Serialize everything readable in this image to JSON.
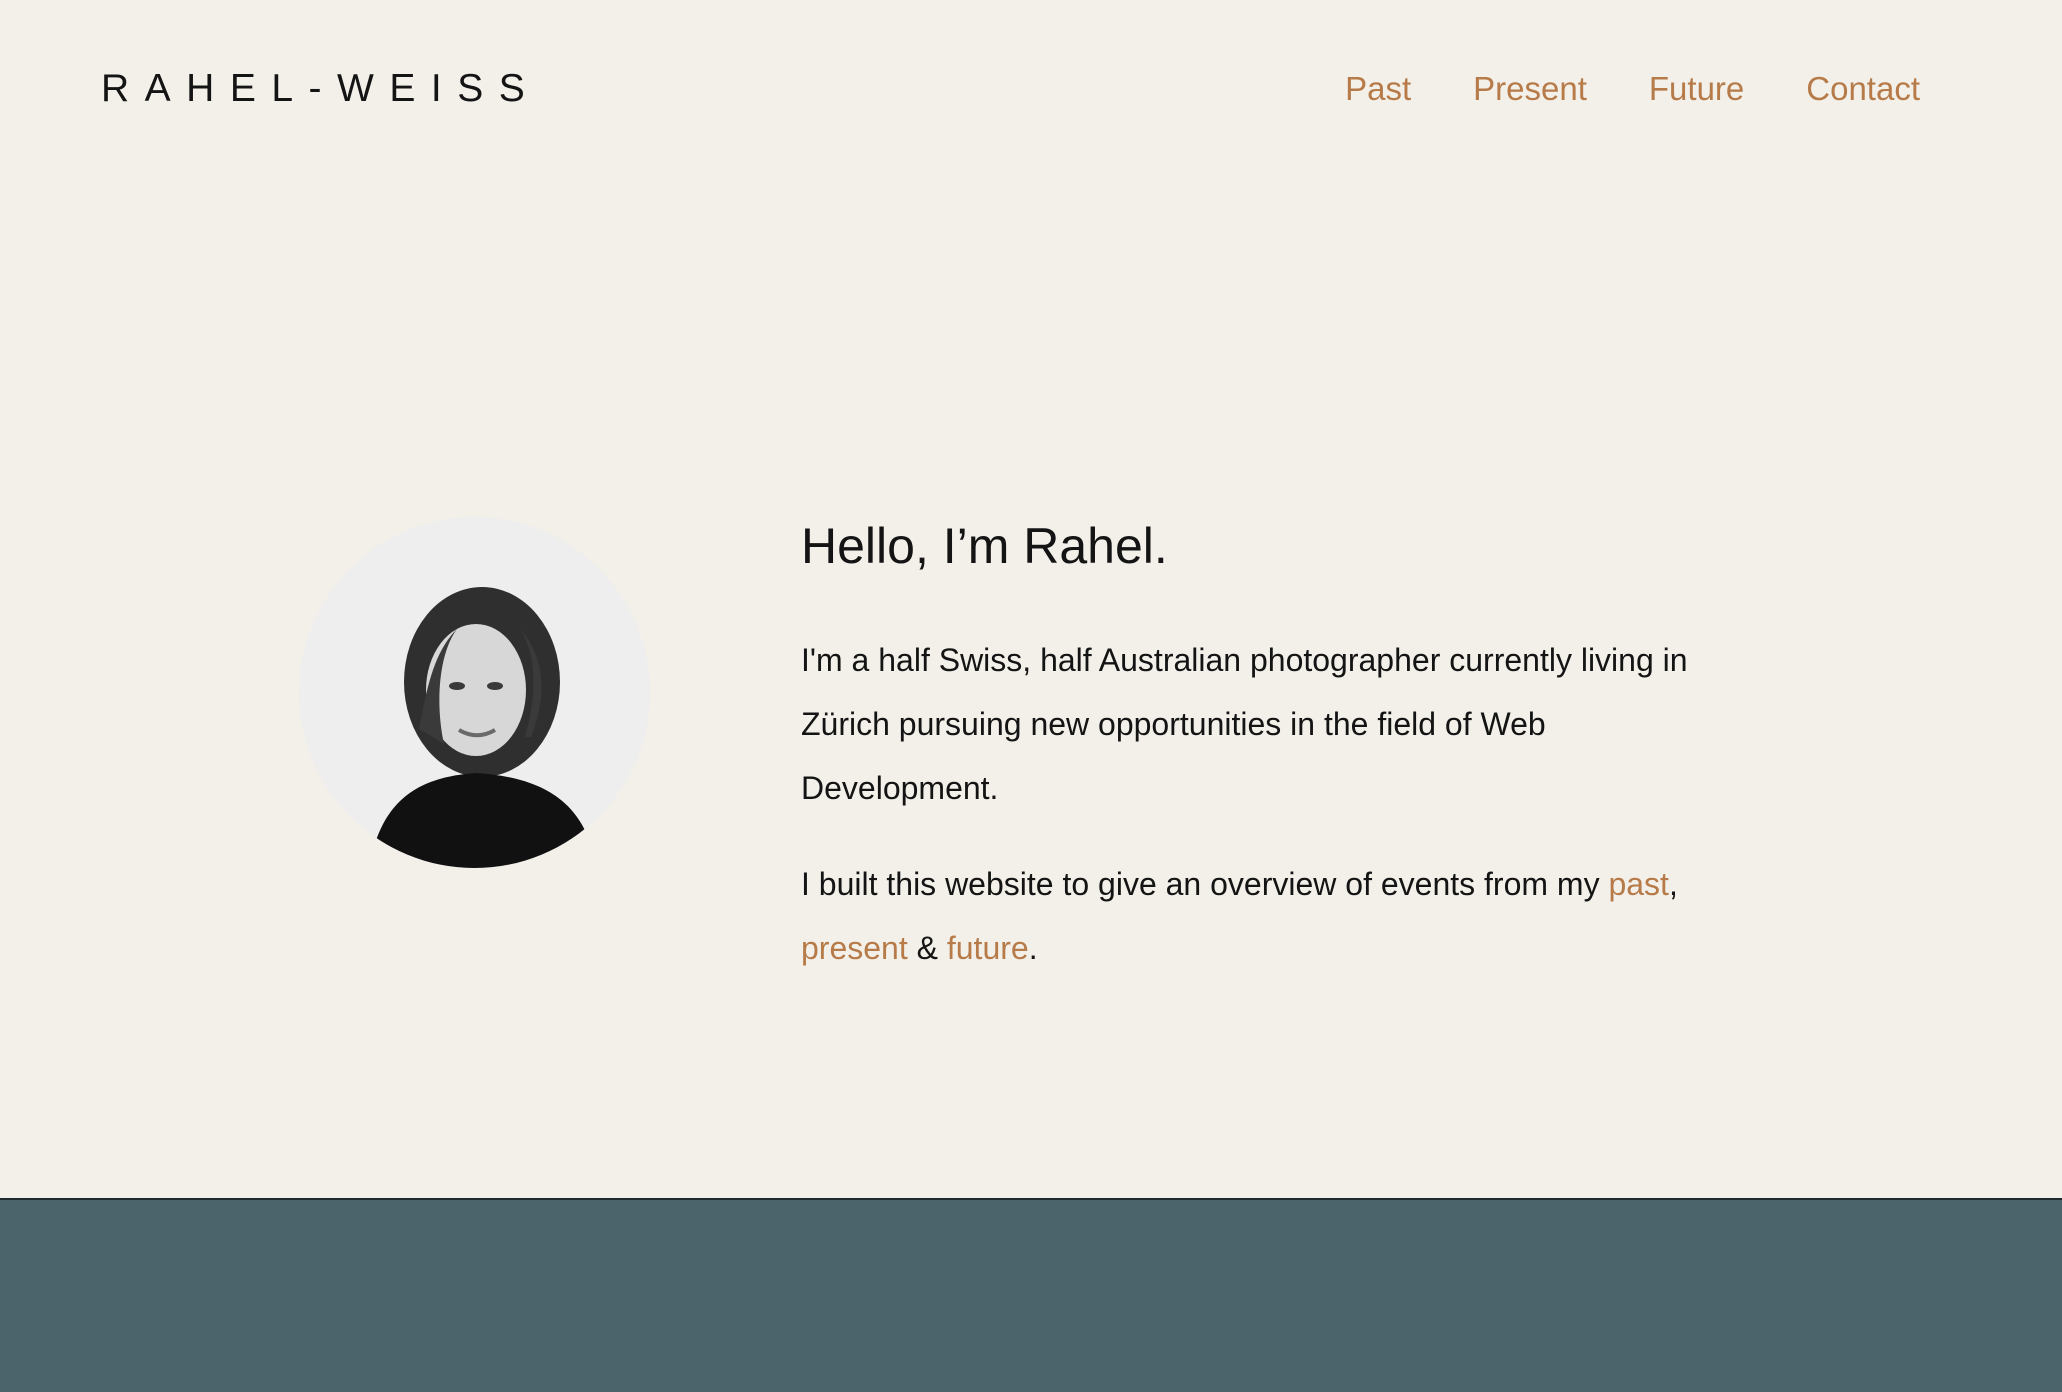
{
  "header": {
    "logo": "RAHEL-WEISS",
    "nav": [
      "Past",
      "Present",
      "Future",
      "Contact"
    ]
  },
  "hero": {
    "title": "Hello, I’m Rahel.",
    "intro": "I'm a half Swiss, half Australian photographer currently living in Zürich pursuing new opportunities in the field of Web Development.",
    "overview_prefix": "I built this website to give an overview of events from my ",
    "link_past": "past",
    "comma": ",",
    "link_present": "present",
    "ampersand": " & ",
    "link_future": "future",
    "period": "."
  },
  "colors": {
    "background": "#f3f0ea",
    "accent": "#b67b49",
    "text": "#141414",
    "footer": "#4b646c"
  }
}
